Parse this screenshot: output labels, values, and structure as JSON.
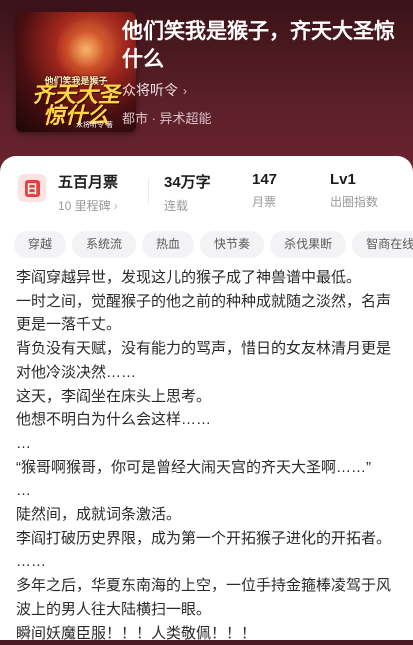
{
  "book": {
    "title": "他们笑我是猴子，齐天大圣惊什么",
    "author": "众将听令",
    "category": "都市 · 异术超能",
    "cover": {
      "small_text": "他们笑我是猴子",
      "big_text": "齐天大圣惊什么",
      "author_text": "众将听令 著"
    }
  },
  "stats": {
    "icon_glyph": "日",
    "monthly_ticket": {
      "value": "五百月票",
      "label": "10 里程碑"
    },
    "word_count": {
      "value": "34万字",
      "label": "连载"
    },
    "tickets": {
      "value": "147",
      "label": "月票"
    },
    "level": {
      "value": "Lv1",
      "label": "出圈指数"
    }
  },
  "tags": [
    "穿越",
    "系统流",
    "热血",
    "快节奏",
    "杀伐果断",
    "智商在线"
  ],
  "description": [
    "李阎穿越异世，发现这儿的猴子成了神兽谱中最低。",
    "一时之间，觉醒猴子的他之前的种种成就随之淡然，名声更是一落千丈。",
    "背负没有天赋，没有能力的骂声，惜日的女友林清月更是对他冷淡决然……",
    "这天，李阎坐在床头上思考。",
    "他想不明白为什么会这样……",
    "…",
    "“猴哥啊猴哥，你可是曾经大闹天宫的齐天大圣啊……”",
    "…",
    "陡然间，成就词条激活。",
    "李阎打破历史界限，成为第一个开拓猴子进化的开拓者。",
    "……",
    "多年之后，华夏东南海的上空，一位手持金箍棒凌驾于风波上的男人往大陆横扫一眼。",
    "瞬间妖魔臣服！！！人类敬佩！！！"
  ]
}
